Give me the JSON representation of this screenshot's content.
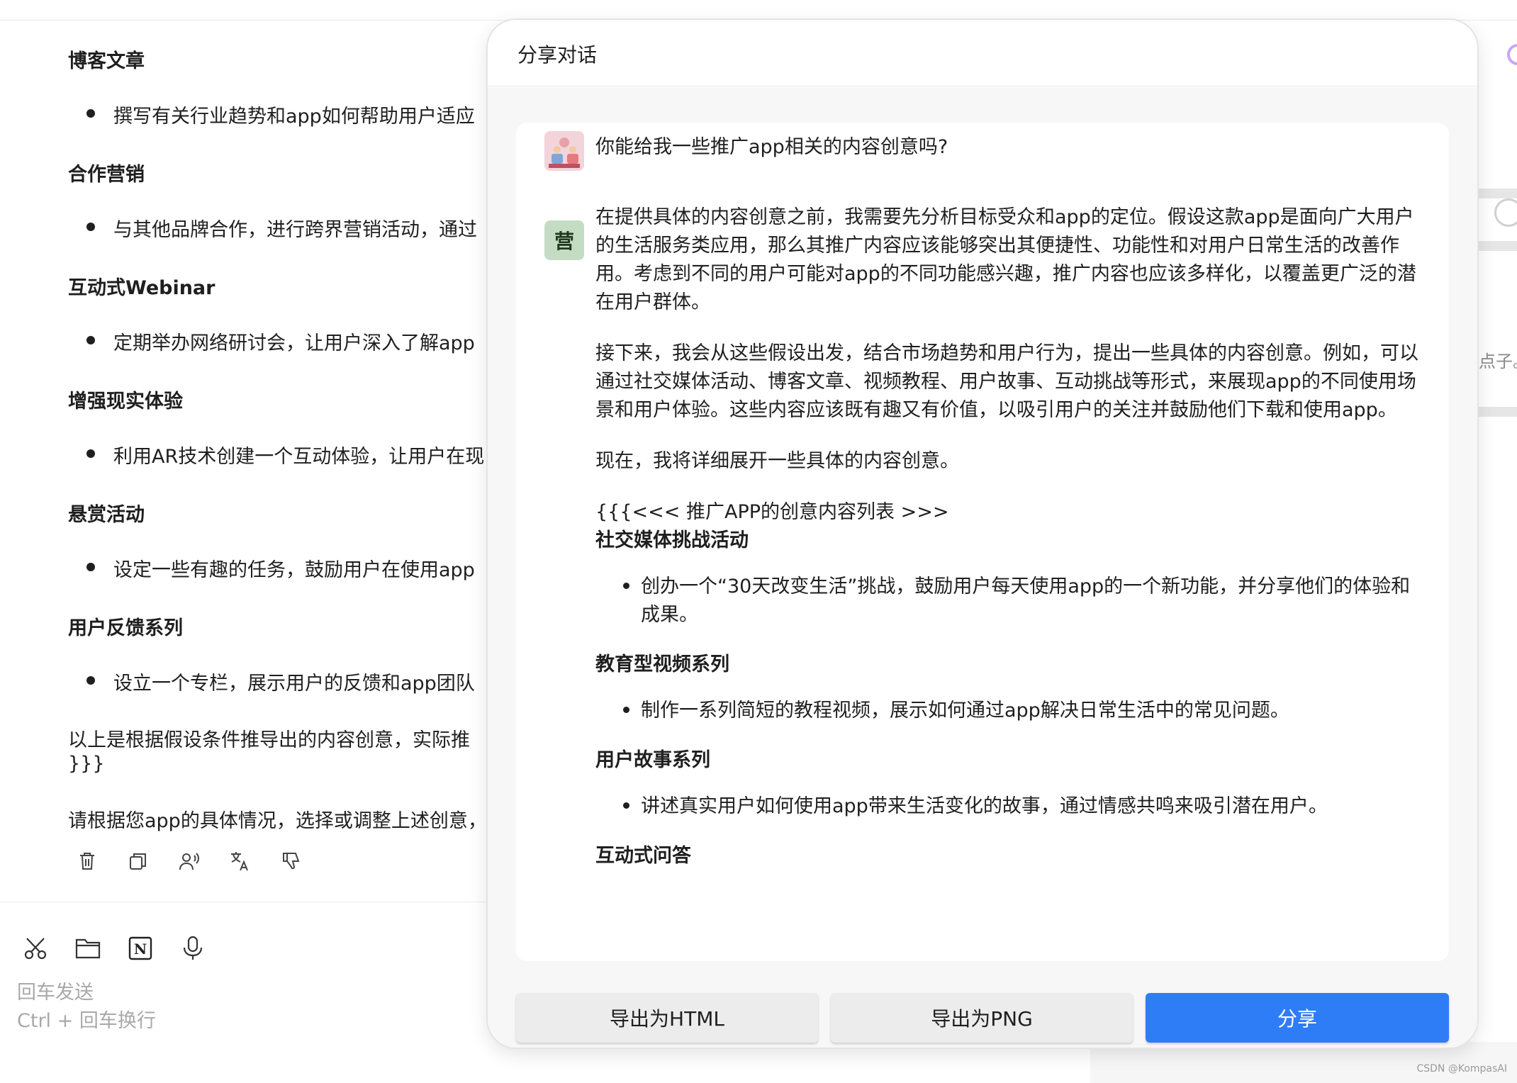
{
  "background_chat": {
    "sections": [
      {
        "title": "博客文章",
        "bullet": "撰写有关行业趋势和app如何帮助用户适应"
      },
      {
        "title": "合作营销",
        "bullet": "与其他品牌合作，进行跨界营销活动，通过"
      },
      {
        "title": "互动式Webinar",
        "bullet": "定期举办网络研讨会，让用户深入了解app"
      },
      {
        "title": "增强现实体验",
        "bullet": "利用AR技术创建一个互动体验，让用户在现"
      },
      {
        "title": "悬赏活动",
        "bullet": "设定一些有趣的任务，鼓励用户在使用app"
      },
      {
        "title": "用户反馈系列",
        "bullet": "设立一个专栏，展示用户的反馈和app团队"
      }
    ],
    "closing_line_1": "以上是根据假设条件推导出的内容创意，实际推",
    "closing_line_2": "}}}",
    "closing_line_3": "请根据您app的具体情况，选择或调整上述创意，"
  },
  "input_area": {
    "hint_line_1": "回车发送",
    "hint_line_2": "Ctrl + 回车换行"
  },
  "right_panel": {
    "partial_text": "点子。"
  },
  "watermark": "CSDN @KompasAI",
  "share_modal": {
    "title": "分享对话",
    "user_question": "你能给我一些推广app相关的内容创意吗?",
    "bot_avatar_text": "营",
    "bot_paragraphs": [
      "在提供具体的内容创意之前，我需要先分析目标受众和app的定位。假设这款app是面向广大用户的生活服务类应用，那么其推广内容应该能够突出其便捷性、功能性和对用户日常生活的改善作用。考虑到不同的用户可能对app的不同功能感兴趣，推广内容也应该多样化，以覆盖更广泛的潜在用户群体。",
      "接下来，我会从这些假设出发，结合市场趋势和用户行为，提出一些具体的内容创意。例如，可以通过社交媒体活动、博客文章、视频教程、用户故事、互动挑战等形式，来展现app的不同使用场景和用户体验。这些内容应该既有趣又有价值，以吸引用户的关注并鼓励他们下载和使用app。",
      "现在，我将详细展开一些具体的内容创意。"
    ],
    "list_header": "{{{<<< 推广APP的创意内容列表 >>>",
    "items": [
      {
        "title": "社交媒体挑战活动",
        "bullet": "创办一个“30天改变生活”挑战，鼓励用户每天使用app的一个新功能，并分享他们的体验和成果。"
      },
      {
        "title": "教育型视频系列",
        "bullet": "制作一系列简短的教程视频，展示如何通过app解决日常生活中的常见问题。"
      },
      {
        "title": "用户故事系列",
        "bullet": "讲述真实用户如何使用app带来生活变化的故事，通过情感共鸣来吸引潜在用户。"
      },
      {
        "title": "互动式问答",
        "bullet": ""
      }
    ],
    "buttons": {
      "export_html": "导出为HTML",
      "export_png": "导出为PNG",
      "share": "分享"
    },
    "colors": {
      "primary": "#2f7df6",
      "secondary": "#ececec",
      "body_bg": "#f7f7f7"
    }
  }
}
